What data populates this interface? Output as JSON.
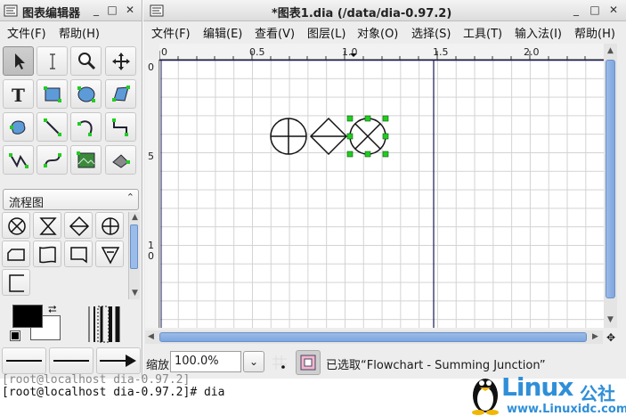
{
  "toolbox": {
    "title": "图表编辑器",
    "menu": {
      "file": "文件(F)",
      "help": "帮助(H)"
    },
    "sheet": "流程图"
  },
  "diagram": {
    "title": "*图表1.dia (/data/dia-0.97.2)",
    "menu": [
      "文件(F)",
      "编辑(E)",
      "查看(V)",
      "图层(L)",
      "对象(O)",
      "选择(S)",
      "工具(T)",
      "输入法(I)",
      "帮助(H)"
    ],
    "hruler_labels": [
      "0",
      "0.5",
      "1.0",
      "1.5",
      "2.0"
    ],
    "vruler_labels": [
      "0",
      "5",
      "1",
      "0"
    ],
    "zoom_label": "缩放",
    "zoom_value": "100.0%",
    "status": "已选取“Flowchart - Summing Junction”"
  },
  "terminal": {
    "line1": "[root@localhost dia-0.97.2]",
    "line2": "[root@localhost dia-0.97.2]# dia"
  },
  "logo": {
    "text": "Linux",
    "suffix": "公社",
    "url": "www.Linuxidc.com"
  },
  "colors": {
    "accent_blue": "#2f8fd8",
    "handle_green": "#22cc22",
    "canvas_line": "#1a1a55"
  }
}
